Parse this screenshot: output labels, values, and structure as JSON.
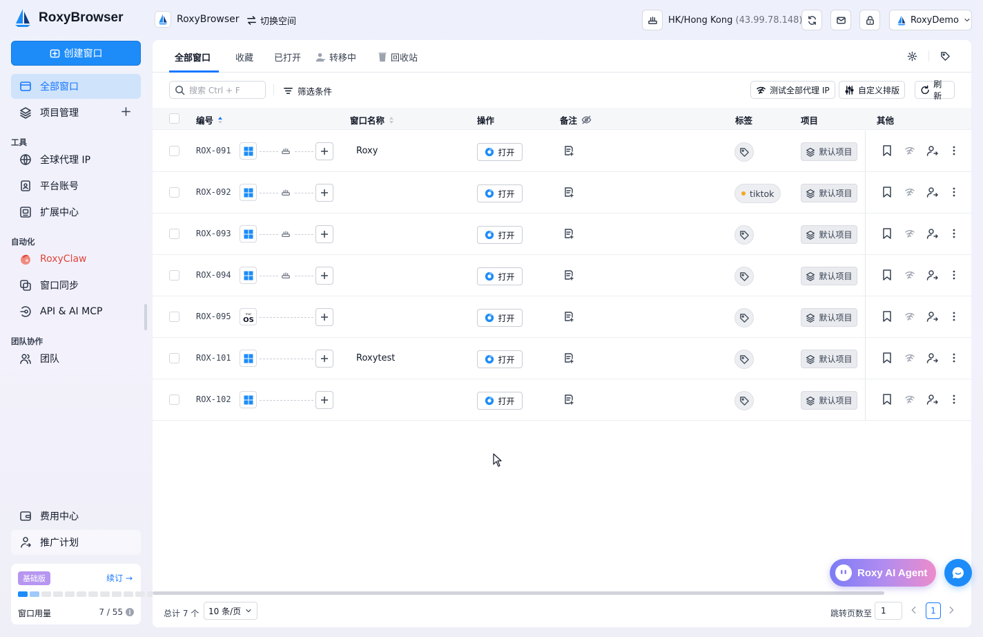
{
  "app": {
    "name": "RoxyBrowser",
    "workspace_name": "RoxyBrowser",
    "switch_label": "切换空间"
  },
  "header": {
    "proxy_location": "HK/Hong Kong",
    "proxy_ip": "(43.99.78.148)",
    "user_name": "RoxyDemo"
  },
  "sidebar": {
    "create_label": "创建窗口",
    "all_windows": "全部窗口",
    "projects": "项目管理",
    "tools_title": "工具",
    "proxy_ip": "全球代理 IP",
    "platform_account": "平台账号",
    "extensions": "扩展中心",
    "automation_title": "自动化",
    "roxyclaw": "RoxyClaw",
    "window_sync": "窗口同步",
    "api_mcp": "API & AI MCP",
    "team_title": "团队协作",
    "team": "团队",
    "billing": "费用中心",
    "affiliate": "推广计划",
    "plan_badge": "基础版",
    "renew": "续订",
    "usage_label": "窗口用量",
    "usage_value": "7 / 55",
    "usage_used": 7,
    "usage_total": 55
  },
  "tabs": {
    "all": "全部窗口",
    "favorites": "收藏",
    "opened": "已打开",
    "transferring": "转移中",
    "recycle": "回收站"
  },
  "toolbar": {
    "search_placeholder": "搜索 Ctrl + F",
    "filter": "筛选条件",
    "test_proxy": "测试全部代理 IP",
    "custom_sort": "自定义排版",
    "refresh": "刷新"
  },
  "table": {
    "columns": {
      "id": "编号",
      "name": "窗口名称",
      "action": "操作",
      "note": "备注",
      "tags": "标签",
      "project": "项目",
      "other": "其他"
    },
    "open_label": "打开",
    "rows": [
      {
        "id": "ROX-091",
        "os": "windows",
        "proxy": true,
        "name": "Roxy",
        "tag": "",
        "project": "默认项目"
      },
      {
        "id": "ROX-092",
        "os": "windows",
        "proxy": true,
        "name": "",
        "tag": "tiktok",
        "project": "默认项目"
      },
      {
        "id": "ROX-093",
        "os": "windows",
        "proxy": true,
        "name": "",
        "tag": "",
        "project": "默认项目"
      },
      {
        "id": "ROX-094",
        "os": "windows",
        "proxy": true,
        "name": "",
        "tag": "",
        "project": "默认项目"
      },
      {
        "id": "ROX-095",
        "os": "macos",
        "proxy": false,
        "name": "",
        "tag": "",
        "project": "默认项目"
      },
      {
        "id": "ROX-101",
        "os": "windows",
        "proxy": false,
        "name": "Roxytest",
        "tag": "",
        "project": "默认项目"
      },
      {
        "id": "ROX-102",
        "os": "windows",
        "proxy": false,
        "name": "",
        "tag": "",
        "project": "默认项目"
      }
    ]
  },
  "footer": {
    "total": "总计 7 个",
    "page_size": "10 条/页",
    "jump_label": "跳转页数至",
    "jump_value": "1",
    "current_page": "1"
  },
  "floating": {
    "agent_label": "Roxy AI Agent"
  },
  "colors": {
    "accent": "#1677ff",
    "primary_button": "#1d8cf8",
    "active_nav_bg": "#cfe3fb",
    "claw_red": "#e0453a",
    "tag_dot": "#f5a623"
  }
}
